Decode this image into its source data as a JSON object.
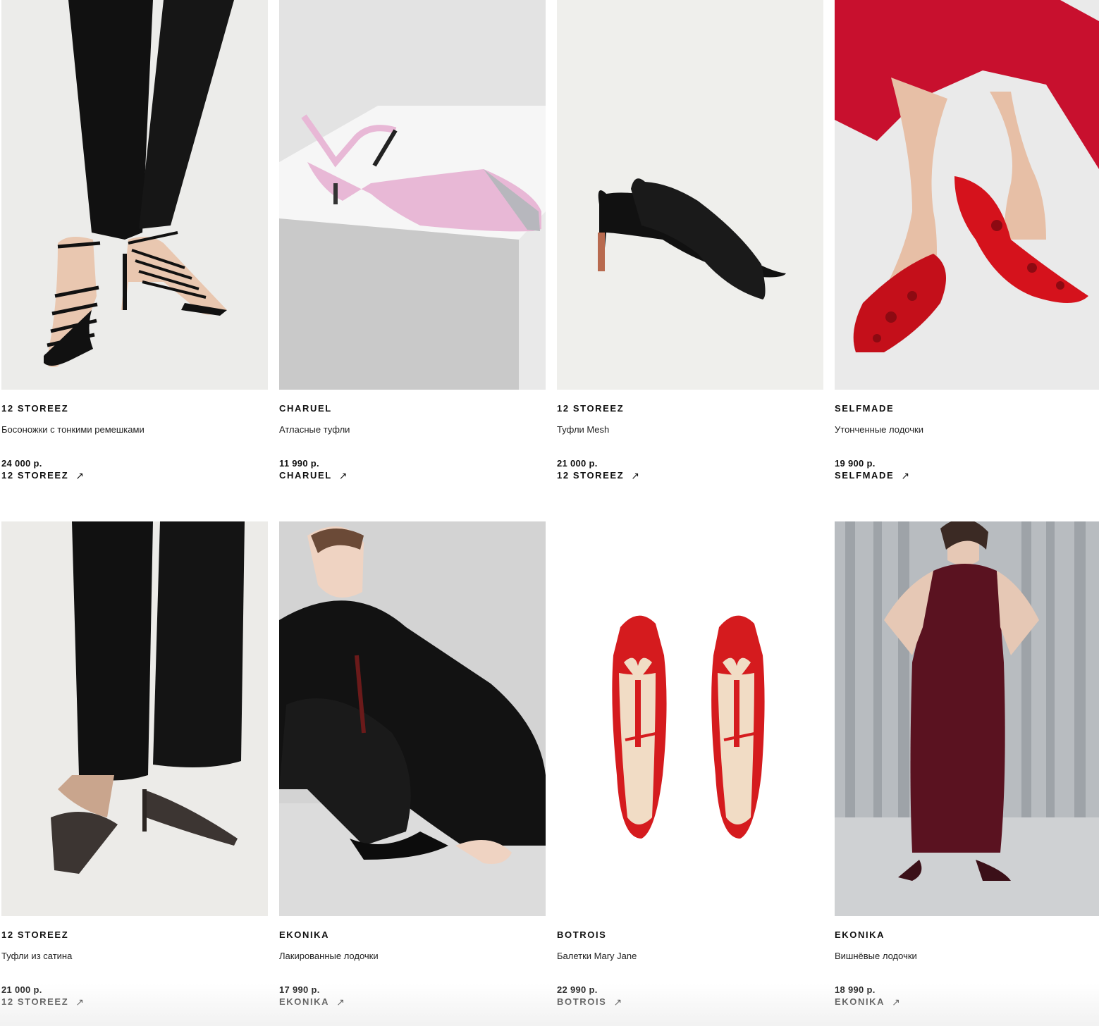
{
  "products": [
    {
      "brand": "12 STOREEZ",
      "name": "Босоножки с тонкими ремешками",
      "price": "24 000 р.",
      "store": "12 STOREEZ",
      "arrow": "↗",
      "image": "black-strappy-sandals-photo"
    },
    {
      "brand": "CHARUEL",
      "name": "Атласные туфли",
      "price": "11 990 р.",
      "store": "CHARUEL",
      "arrow": "↗",
      "image": "pink-satin-slingback-photo"
    },
    {
      "brand": "12 STOREEZ",
      "name": "Туфли Mesh",
      "price": "21 000 р.",
      "store": "12 STOREEZ",
      "arrow": "↗",
      "image": "black-mesh-pumps-photo"
    },
    {
      "brand": "SELFMADE",
      "name": "Утонченные лодочки",
      "price": "19 900 р.",
      "store": "SELFMADE",
      "arrow": "↗",
      "image": "red-ruffle-pumps-photo"
    },
    {
      "brand": "12 STOREEZ",
      "name": "Туфли из сатина",
      "price": "21 000 р.",
      "store": "12 STOREEZ",
      "arrow": "↗",
      "image": "brown-satin-pumps-photo"
    },
    {
      "brand": "EKONIKA",
      "name": "Лакированные лодочки",
      "price": "17 990 р.",
      "store": "EKONIKA",
      "arrow": "↗",
      "image": "model-black-outfit-photo"
    },
    {
      "brand": "BOTROIS",
      "name": "Балетки Mary Jane",
      "price": "22 990 р.",
      "store": "BOTROIS",
      "arrow": "↗",
      "image": "red-mary-jane-flats-photo"
    },
    {
      "brand": "EKONIKA",
      "name": "Вишнёвые лодочки",
      "price": "18 990 р.",
      "store": "EKONIKA",
      "arrow": "↗",
      "image": "model-cherry-dress-photo"
    }
  ]
}
